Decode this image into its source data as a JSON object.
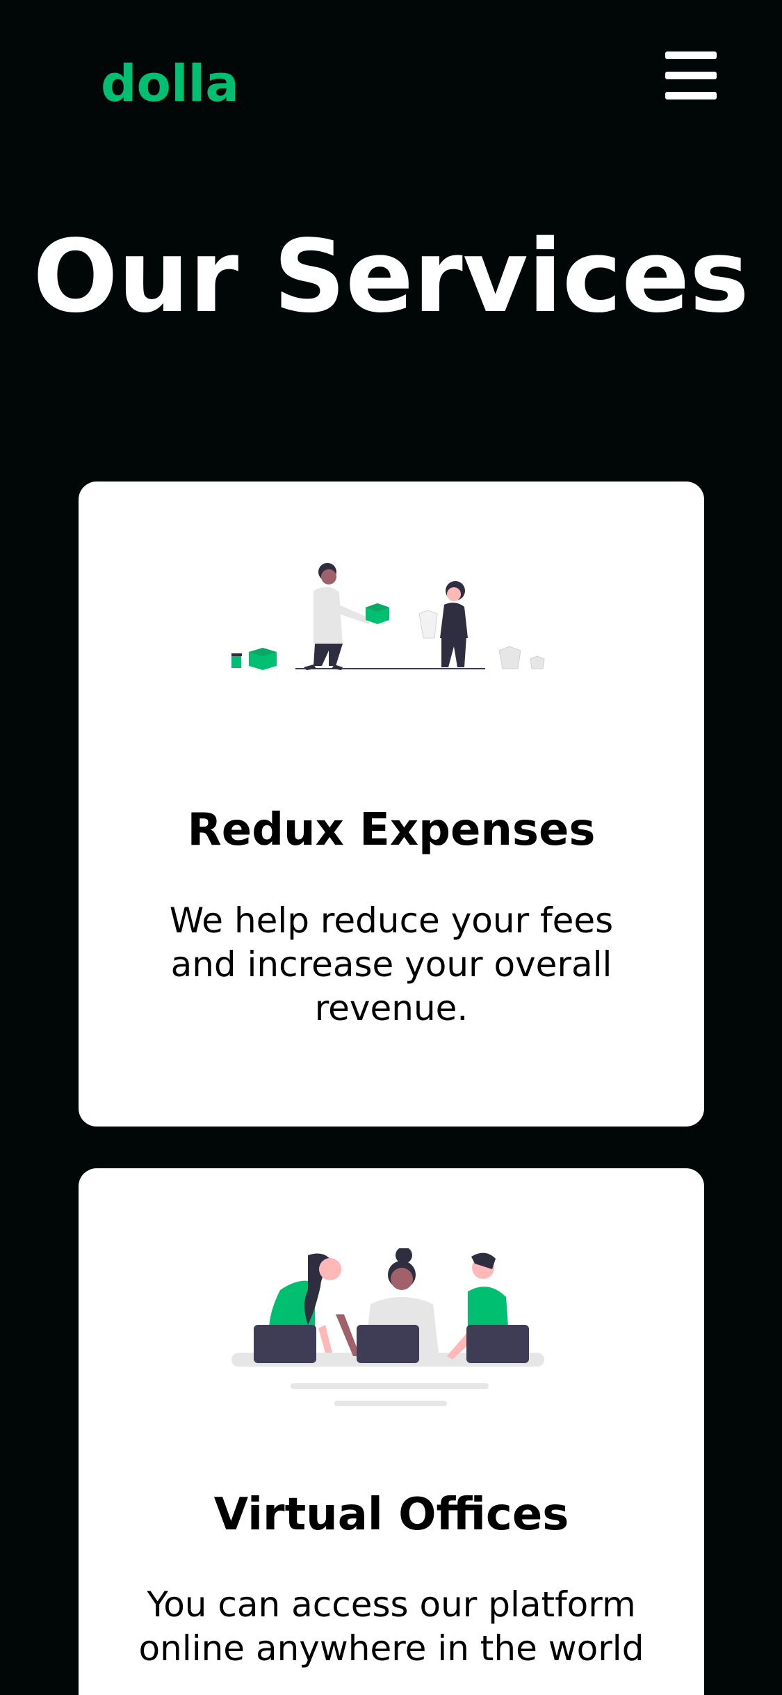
{
  "navbar": {
    "logo": "dolla",
    "menu_icon": "hamburger-menu-icon"
  },
  "services": {
    "title": "Our Services",
    "cards": [
      {
        "illustration": "delivery-illustration",
        "title": "Redux Expenses",
        "text": "We help reduce your fees and increase your overall revenue."
      },
      {
        "illustration": "team-working-illustration",
        "title": "Virtual Offices",
        "text": "You can access our platform online anywhere in the world"
      }
    ]
  },
  "colors": {
    "background": "#010606",
    "accent": "#01bf71",
    "card": "#ffffff"
  }
}
